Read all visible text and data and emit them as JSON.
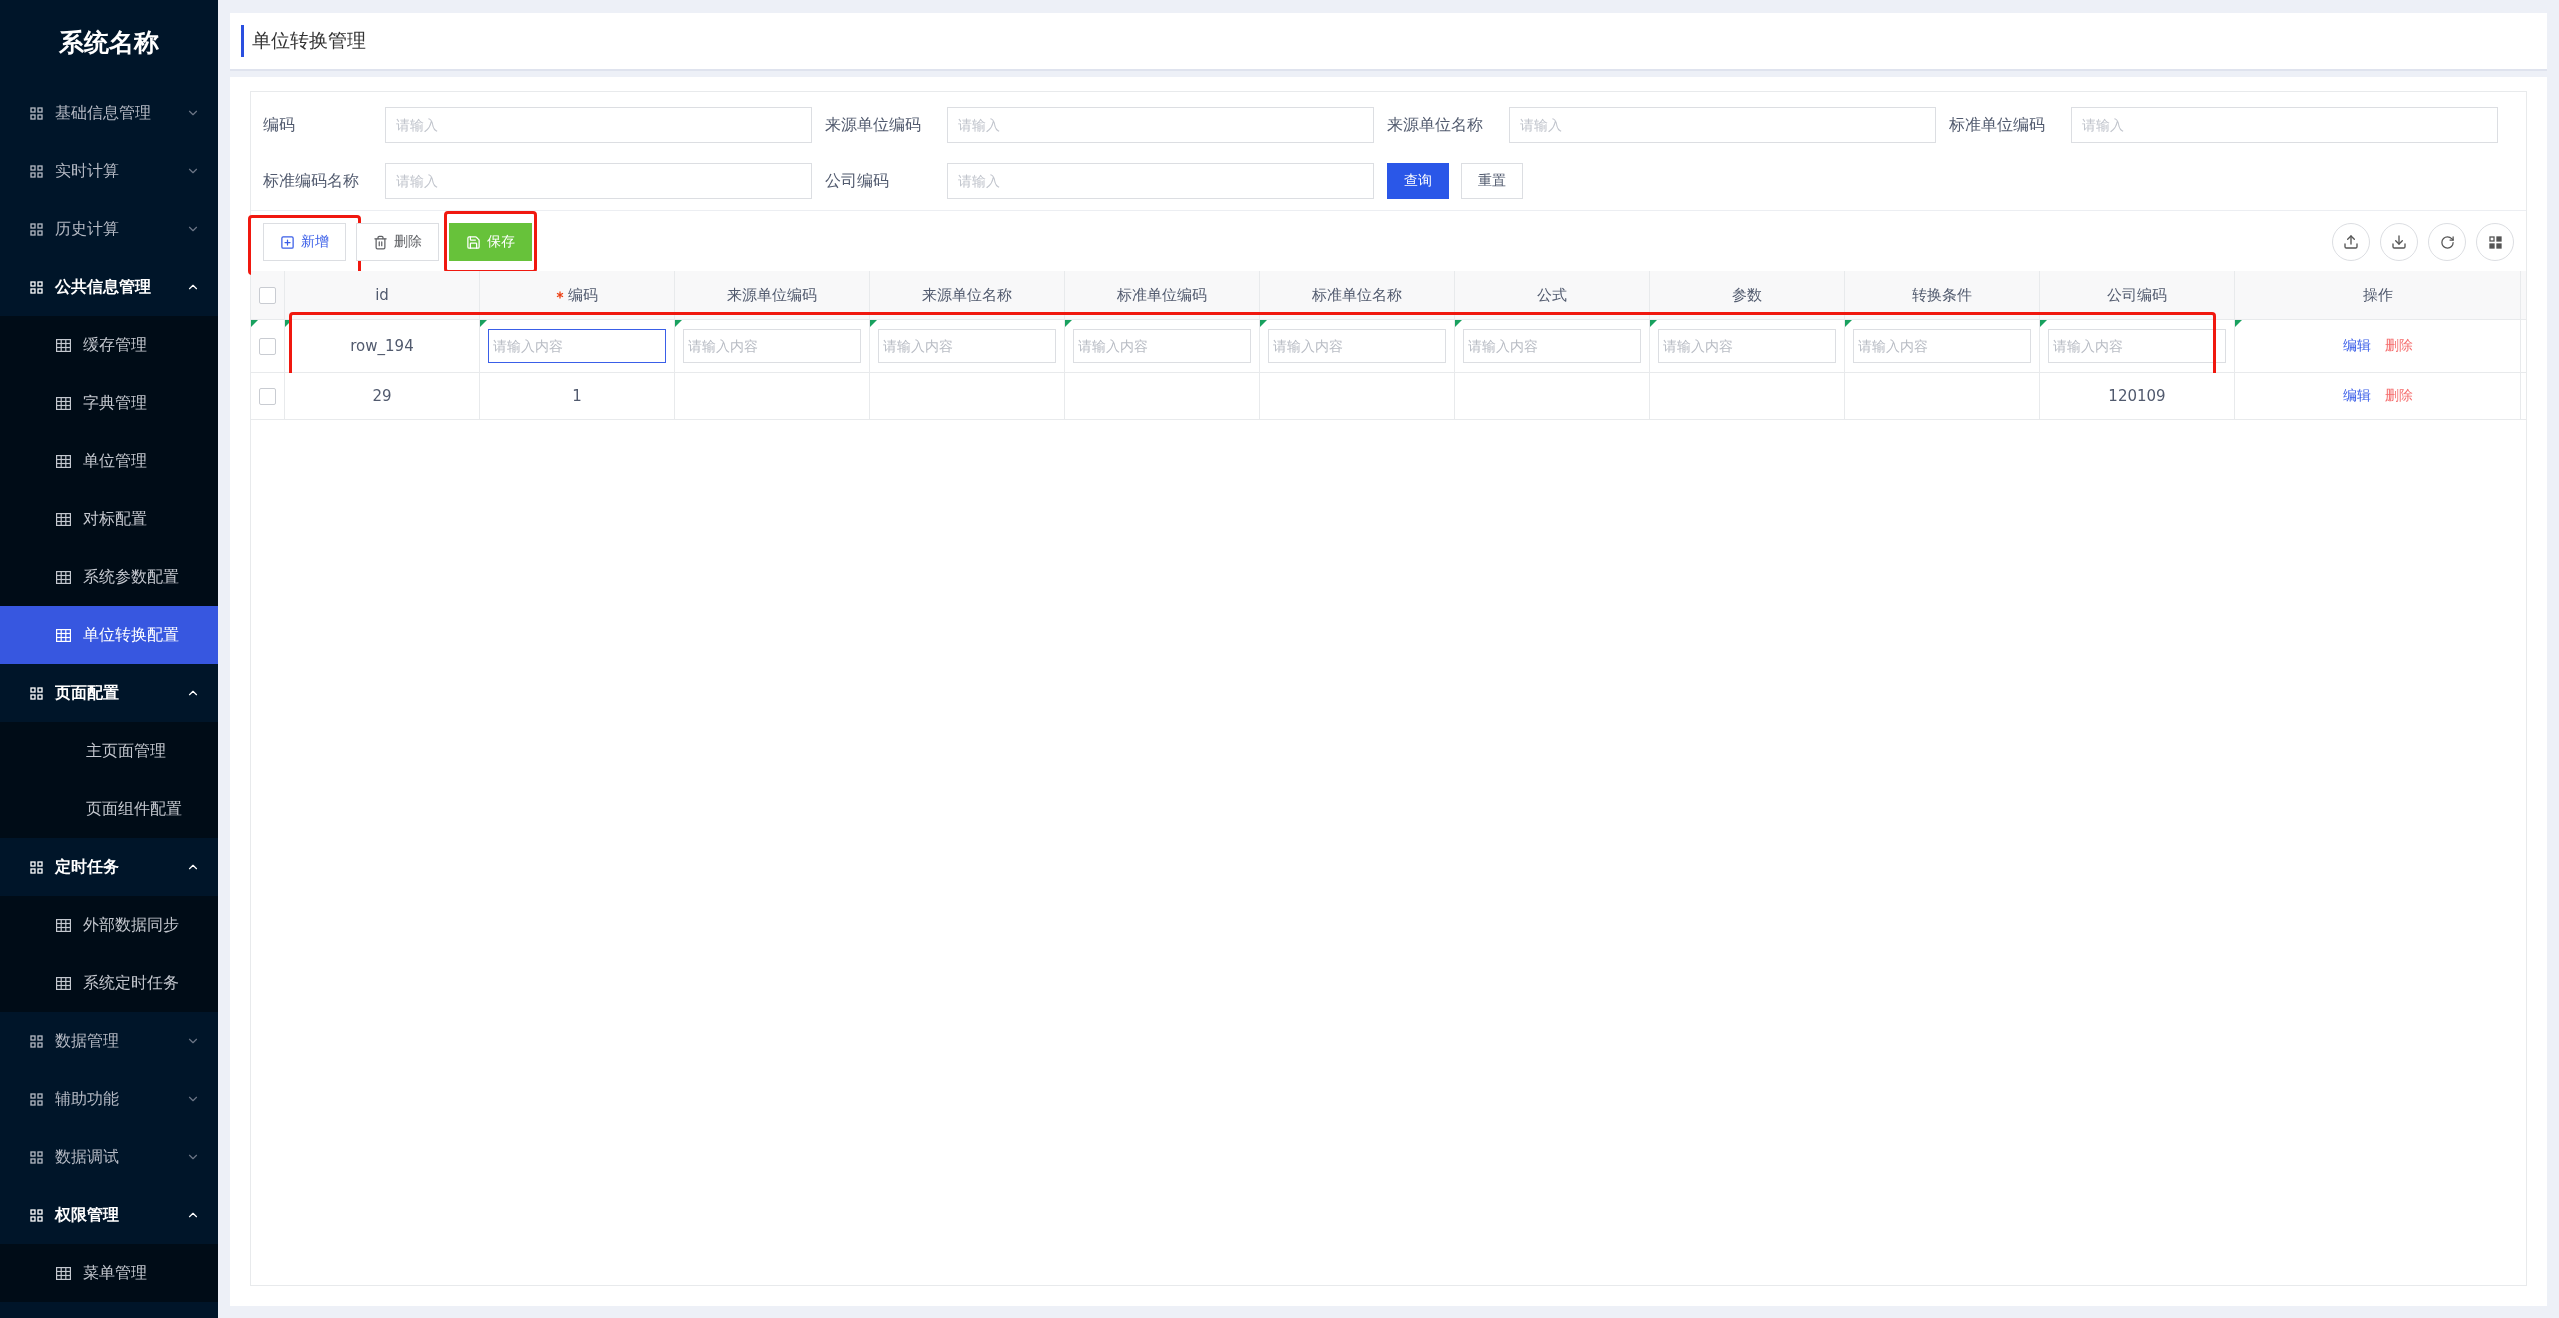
{
  "sidebar": {
    "title": "系统名称",
    "groups": [
      {
        "label": "基础信息管理",
        "expanded": false
      },
      {
        "label": "实时计算",
        "expanded": false
      },
      {
        "label": "历史计算",
        "expanded": false
      },
      {
        "label": "公共信息管理",
        "expanded": true,
        "children": [
          {
            "label": "缓存管理",
            "kind": "icon",
            "selected": false
          },
          {
            "label": "字典管理",
            "kind": "icon",
            "selected": false
          },
          {
            "label": "单位管理",
            "kind": "icon",
            "selected": false
          },
          {
            "label": "对标配置",
            "kind": "icon",
            "selected": false
          },
          {
            "label": "系统参数配置",
            "kind": "icon",
            "selected": false
          },
          {
            "label": "单位转换配置",
            "kind": "icon",
            "selected": true
          }
        ]
      },
      {
        "label": "页面配置",
        "expanded": true,
        "children": [
          {
            "label": "主页面管理",
            "kind": "plain",
            "selected": false
          },
          {
            "label": "页面组件配置",
            "kind": "plain",
            "selected": false
          }
        ]
      },
      {
        "label": "定时任务",
        "expanded": true,
        "children": [
          {
            "label": "外部数据同步",
            "kind": "icon",
            "selected": false
          },
          {
            "label": "系统定时任务",
            "kind": "icon",
            "selected": false
          }
        ]
      },
      {
        "label": "数据管理",
        "expanded": false
      },
      {
        "label": "辅助功能",
        "expanded": false
      },
      {
        "label": "数据调试",
        "expanded": false
      },
      {
        "label": "权限管理",
        "expanded": true,
        "children": [
          {
            "label": "菜单管理",
            "kind": "icon",
            "selected": false
          }
        ]
      }
    ]
  },
  "page_title": "单位转换管理",
  "filters": [
    {
      "label": "编码",
      "placeholder": "请输入"
    },
    {
      "label": "来源单位编码",
      "placeholder": "请输入"
    },
    {
      "label": "来源单位名称",
      "placeholder": "请输入"
    },
    {
      "label": "标准单位编码",
      "placeholder": "请输入"
    },
    {
      "label": "标准编码名称",
      "placeholder": "请输入"
    },
    {
      "label": "公司编码",
      "placeholder": "请输入"
    }
  ],
  "filter_buttons": [
    {
      "label": "查询",
      "kind": "primary"
    },
    {
      "label": "重置",
      "kind": "default"
    }
  ],
  "toolbar": [
    {
      "label": "新增",
      "kind": "add",
      "highlighted": true
    },
    {
      "label": "删除",
      "kind": "delete",
      "highlighted": false
    },
    {
      "label": "保存",
      "kind": "save",
      "highlighted": true
    }
  ],
  "table": {
    "all_checked": false,
    "columns": [
      {
        "label": "id",
        "required": false
      },
      {
        "label": "编码",
        "required": true
      },
      {
        "label": "来源单位编码",
        "required": false
      },
      {
        "label": "来源单位名称",
        "required": false
      },
      {
        "label": "标准单位编码",
        "required": false
      },
      {
        "label": "标准单位名称",
        "required": false
      },
      {
        "label": "公式",
        "required": false
      },
      {
        "label": "参数",
        "required": false
      },
      {
        "label": "转换条件",
        "required": false
      },
      {
        "label": "公司编码",
        "required": false
      }
    ],
    "action_column": "操作",
    "rows": [
      {
        "checked": false,
        "changed": true,
        "highlighted": true,
        "cells": [
          {
            "value": "row_194"
          },
          {
            "placeholder": "请输入内容",
            "focused": true
          },
          {
            "placeholder": "请输入内容",
            "focused": false
          },
          {
            "placeholder": "请输入内容",
            "focused": false
          },
          {
            "placeholder": "请输入内容",
            "focused": false
          },
          {
            "placeholder": "请输入内容",
            "focused": false
          },
          {
            "placeholder": "请输入内容",
            "focused": false
          },
          {
            "placeholder": "请输入内容",
            "focused": false
          },
          {
            "placeholder": "请输入内容",
            "focused": false
          },
          {
            "placeholder": "请输入内容",
            "focused": false
          }
        ],
        "actions": [
          {
            "label": "编辑",
            "kind": "edit"
          },
          {
            "label": "删除",
            "kind": "delete"
          }
        ]
      },
      {
        "checked": false,
        "changed": false,
        "highlighted": false,
        "cells": [
          {
            "value": "29"
          },
          {
            "value": "1"
          },
          null,
          null,
          null,
          null,
          null,
          null,
          null,
          {
            "value": "120109"
          }
        ],
        "actions": [
          {
            "label": "编辑",
            "kind": "edit"
          },
          {
            "label": "删除",
            "kind": "delete"
          }
        ]
      }
    ]
  }
}
